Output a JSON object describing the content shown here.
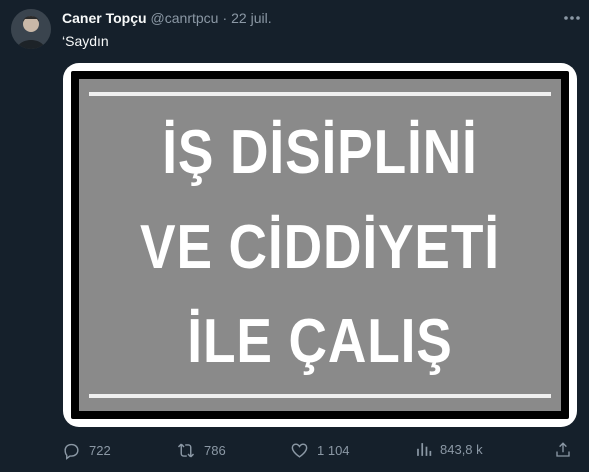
{
  "tweet": {
    "author_name": "Caner Topçu",
    "handle": "@canrtpcu",
    "separator": "·",
    "date": "22 juil.",
    "text": "‘Saydın"
  },
  "media": {
    "sign_lines": [
      "İŞ DİSİPLİNİ",
      "VE CİDDİYETİ",
      "İLE ÇALIŞ"
    ],
    "colors": {
      "panel": "#8a8a8a",
      "border": "#000000",
      "frame": "#ffffff",
      "text": "#ffffff"
    }
  },
  "actions": {
    "replies": "722",
    "retweets": "786",
    "likes": "1 104",
    "views": "843,8 k"
  },
  "icons": [
    "more-icon",
    "reply-icon",
    "retweet-icon",
    "like-icon",
    "views-icon",
    "share-icon"
  ],
  "colors": {
    "background": "#15202b",
    "muted": "#8b98a5",
    "text": "#f7f9f9"
  }
}
